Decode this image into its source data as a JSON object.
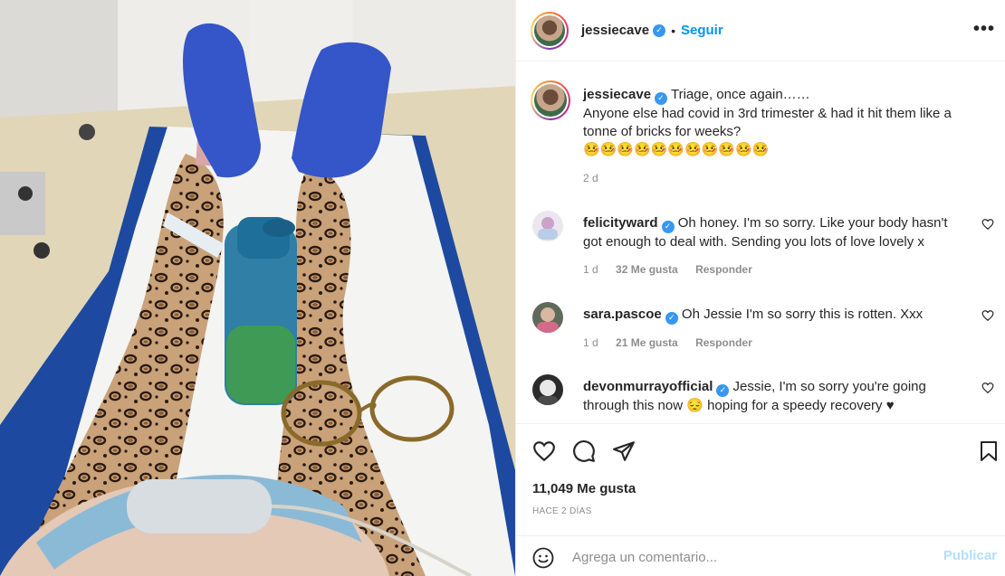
{
  "post": {
    "author": "jessiecave",
    "follow_label": "Seguir",
    "separator": "•",
    "more_label": "•••",
    "caption_line1": "Triage, once again……",
    "caption_line2": "Anyone else had covid in 3rd trimester & had it hit them like a tonne of bricks for weeks?",
    "caption_emojis": "🤒🤒🤒🤒🤒🤒🤒🤒🤒🤒🤒",
    "caption_time": "2 d"
  },
  "comments": [
    {
      "user": "felicityward",
      "text": "Oh honey. I'm so sorry. Like your body hasn't got enough to deal with. Sending you lots of love lovely x",
      "time": "1 d",
      "likes": "32 Me gusta",
      "reply": "Responder"
    },
    {
      "user": "sara.pascoe",
      "text": "Oh Jessie I'm so sorry this is rotten. Xxx",
      "time": "1 d",
      "likes": "21 Me gusta",
      "reply": "Responder"
    },
    {
      "user": "devonmurrayofficial",
      "text": "Jessie, I'm so sorry you're going through this now 😔 hoping for a speedy recovery ♥",
      "time": "",
      "likes": "",
      "reply": ""
    }
  ],
  "footer": {
    "likes_count": "11,049 Me gusta",
    "ago": "HACE 2 DÍAS",
    "comment_placeholder": "Agrega un comentario...",
    "post_label": "Publicar"
  },
  "icons": {
    "verified": "verified-badge-icon",
    "like": "heart-icon",
    "comment": "comment-bubble-icon",
    "share": "paper-plane-icon",
    "save": "bookmark-icon",
    "emoji": "smiley-icon",
    "more": "more-dots-icon"
  },
  "colors": {
    "link_blue": "#0095f6",
    "verified_blue": "#3897f0",
    "muted": "#8e8e8e",
    "post_disabled": "#b2dffc",
    "text": "#262626"
  }
}
